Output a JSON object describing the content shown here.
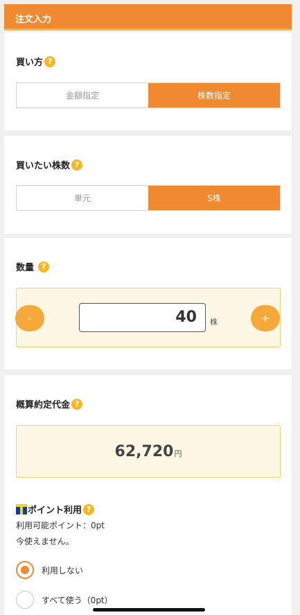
{
  "header": {
    "title": "注文入力"
  },
  "buy_method": {
    "label": "買い方",
    "help": "?",
    "options": [
      "金額指定",
      "株数指定"
    ],
    "selected": "株数指定"
  },
  "share_type": {
    "label": "買いたい株数",
    "help": "?",
    "options": [
      "単元",
      "S株"
    ],
    "selected": "S株"
  },
  "quantity": {
    "label": "数量",
    "help": "?",
    "minus_label": "-",
    "plus_label": "+",
    "value": "40",
    "unit": "株"
  },
  "estimate": {
    "label": "概算約定代金",
    "help": "?",
    "value": "62,720",
    "unit": "円"
  },
  "tpoint": {
    "label": "ポイント利用",
    "help": "?",
    "available": "利用可能ポイント：0pt",
    "note": "今使えません。",
    "options": [
      {
        "label": "利用しない",
        "checked": true
      },
      {
        "label": "すべて使う（0pt）",
        "checked": false
      }
    ]
  },
  "colors": {
    "accent": "#f08a30",
    "help_badge": "#f5b825",
    "panel_bg": "#fdf8e6",
    "panel_border": "#f2d06a"
  }
}
